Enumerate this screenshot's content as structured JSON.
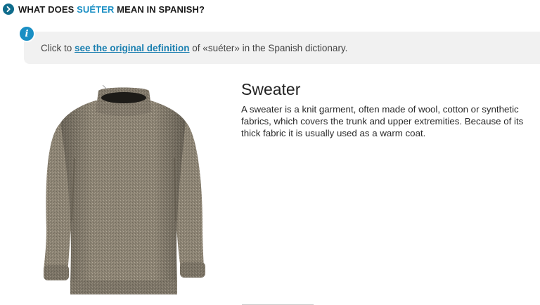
{
  "header": {
    "prefix": "WHAT DOES ",
    "word": "SUÉTER",
    "suffix": " MEAN IN SPANISH?",
    "accent_color": "#1a8fc4",
    "icon": "chevron-right-icon"
  },
  "info": {
    "icon": "info-icon",
    "text_before": "Click to ",
    "link_text": "see the original definition",
    "text_after": " of «suéter» in the Spanish dictionary."
  },
  "image": {
    "subject": "sweater-image",
    "colors": {
      "knit": "#8f8676",
      "shadow": "#5e574b",
      "neck": "#1f1d1a"
    }
  },
  "definition": {
    "title": "Sweater",
    "body": "A sweater is a knit garment, often made of wool, cotton or synthetic fabrics, which covers the trunk and upper extremities. Because of its thick fabric it is usually used as a warm coat."
  }
}
